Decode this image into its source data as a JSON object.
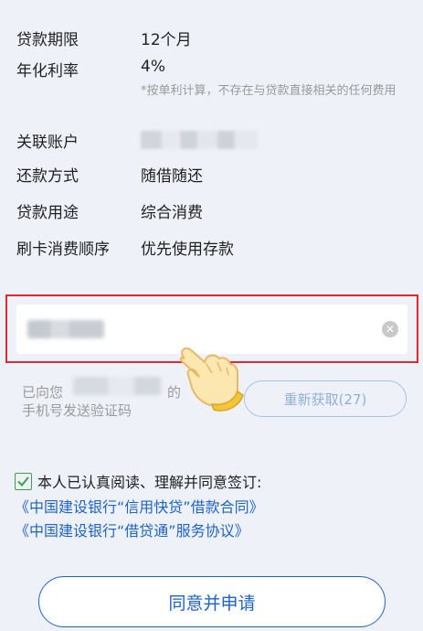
{
  "details": [
    {
      "label": "贷款期限",
      "value": "12个月"
    },
    {
      "label": "年化利率",
      "value": "4%"
    },
    {
      "label": "关联账户",
      "value": ""
    },
    {
      "label": "还款方式",
      "value": "随借随还"
    },
    {
      "label": "贷款用途",
      "value": "综合消费"
    },
    {
      "label": "刷卡消费顺序",
      "value": "优先使用存款"
    }
  ],
  "rate_note": "*按单利计算，不存在与贷款直接相关的任何费用",
  "sms": {
    "prefix": "已向您",
    "suffix": "的",
    "line2": "手机号发送验证码",
    "resend_label": "重新获取(27)"
  },
  "agreement": {
    "text": "本人已认真阅读、理解并同意签订:",
    "links": [
      "《中国建设银行“信用快贷”借款合同》",
      "《中国建设银行“借贷通”服务协议》"
    ]
  },
  "submit_label": "同意并申请",
  "colors": {
    "accent": "#1e63c8",
    "highlight_border": "#e0292f",
    "check": "#3aa04a",
    "background": "#eef2f8"
  }
}
